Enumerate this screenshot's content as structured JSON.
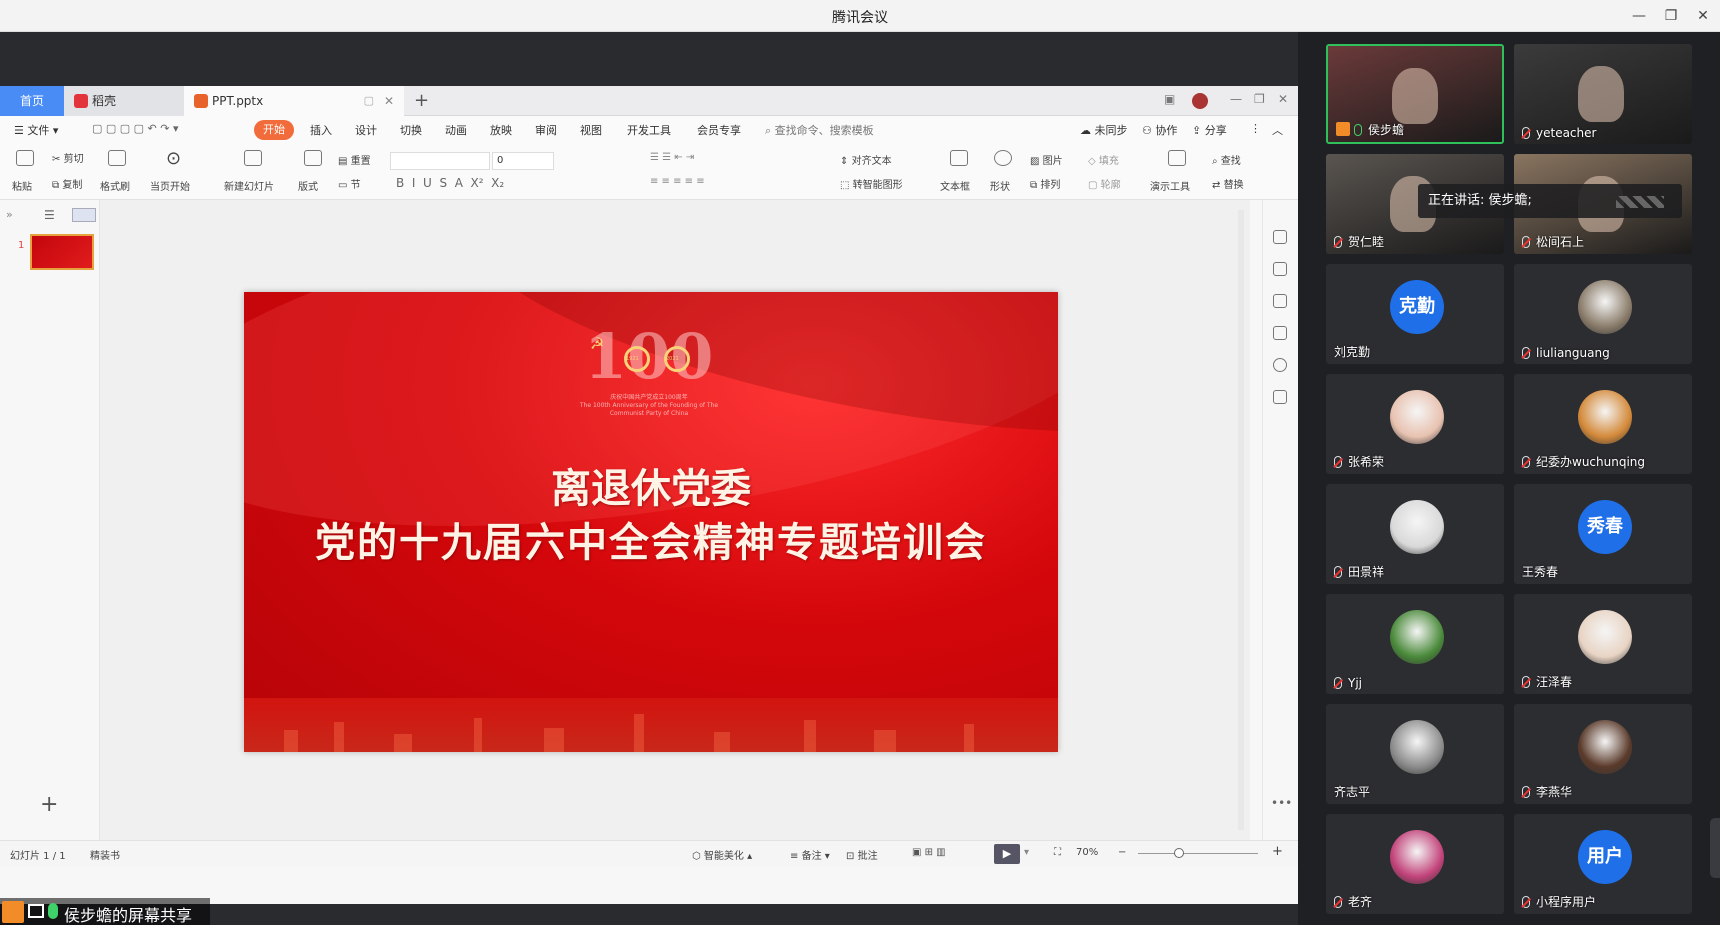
{
  "app": {
    "title": "腾讯会议"
  },
  "wps": {
    "tabs": [
      {
        "label": "首页"
      },
      {
        "label": "稻壳"
      },
      {
        "label": "PPT.pptx"
      }
    ],
    "menu": [
      "文件",
      "开始",
      "插入",
      "设计",
      "切换",
      "动画",
      "放映",
      "审阅",
      "视图",
      "开发工具",
      "会员专享"
    ],
    "search_placeholder": "查找命令、搜索模板",
    "right_menu": {
      "sync": "未同步",
      "collab": "协作",
      "share": "分享"
    },
    "ribbon": {
      "paste": "粘贴",
      "cut": "剪切",
      "copy": "复制",
      "format": "格式刷",
      "play_from": "当页开始",
      "new_slide": "新建幻灯片",
      "layout": "版式",
      "section": "节",
      "reset": "重置",
      "font_size": "0",
      "align_text": "对齐文本",
      "smart_shape": "转智能图形",
      "textbox": "文本框",
      "shape": "形状",
      "picture": "图片",
      "fill": "填充",
      "arrange": "排列",
      "outline": "轮廓",
      "present_tools": "演示工具",
      "find": "查找",
      "replace": "替换"
    },
    "slide": {
      "number": "1",
      "logo_number": "100",
      "logo_year_1": "1921",
      "logo_year_2": "2021",
      "logo_caption_1": "庆祝中国共产党成立100周年",
      "logo_caption_2": "The 100th Anniversary of the Founding of The Communist Party of China",
      "title_line1": "离退休党委",
      "title_line2": "党的十九届六中全会精神专题培训会"
    },
    "status": {
      "slide_counter": "幻灯片 1 / 1",
      "theme": "精装书",
      "beautify": "智能美化",
      "notes": "备注",
      "comment": "批注",
      "zoom": "70%"
    }
  },
  "share_label": "侯步蟾的屏幕共享",
  "speaking_label": "正在讲话: 侯步蟾;",
  "participants": [
    {
      "name": "侯步蟾",
      "mic": "on",
      "type": "video",
      "bg": "#6b3a3a",
      "active": true
    },
    {
      "name": "yeteacher",
      "mic": "off",
      "type": "video",
      "bg": "#3b3b3b"
    },
    {
      "name": "贺仁睦",
      "mic": "off",
      "type": "video",
      "bg": "#5a5550"
    },
    {
      "name": "松间石上",
      "mic": "off",
      "type": "video",
      "bg": "#8a7560"
    },
    {
      "name": "刘克勤",
      "mic": "none",
      "type": "initial",
      "initial": "克勤",
      "color": "#1e6fe8"
    },
    {
      "name": "liulianguang",
      "mic": "off",
      "type": "photo",
      "color": "#8b7d6b"
    },
    {
      "name": "张希荣",
      "mic": "off",
      "type": "photo",
      "color": "#e8c2b0"
    },
    {
      "name": "纪委办wuchunqing",
      "mic": "off",
      "type": "photo",
      "color": "#d48a3a"
    },
    {
      "name": "田景祥",
      "mic": "off",
      "type": "photo",
      "color": "#d9d9d9"
    },
    {
      "name": "王秀春",
      "mic": "none",
      "type": "initial",
      "initial": "秀春",
      "color": "#1e6fe8"
    },
    {
      "name": "Yjj",
      "mic": "off",
      "type": "photo",
      "color": "#4a8a3a"
    },
    {
      "name": "汪泽春",
      "mic": "off",
      "type": "photo",
      "color": "#e8d4c4"
    },
    {
      "name": "齐志平",
      "mic": "none",
      "type": "photo",
      "color": "#8c8c8c"
    },
    {
      "name": "李燕华",
      "mic": "off",
      "type": "photo",
      "color": "#5a3a2a"
    },
    {
      "name": "老齐",
      "mic": "off",
      "type": "photo",
      "color": "#c2437a"
    },
    {
      "name": "小程序用户",
      "mic": "off",
      "type": "initial",
      "initial": "用户",
      "color": "#1e6fe8"
    }
  ]
}
